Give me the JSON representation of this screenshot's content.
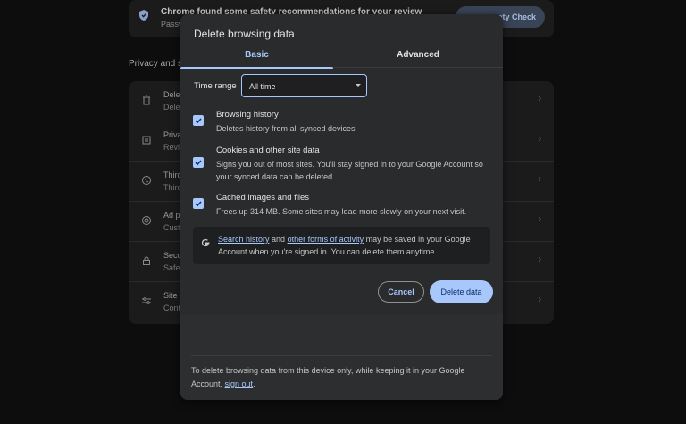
{
  "background": {
    "safety": {
      "title": "Chrome found some safety recommendations for your review",
      "subtitle": "Passw",
      "button": "ety Check"
    },
    "section_heading": "Privacy and s",
    "rows": [
      {
        "icon": "trash-icon",
        "l1": "Dele",
        "l2": "Delet"
      },
      {
        "icon": "privacy-guide-icon",
        "l1": "Priva",
        "l2": "Revie"
      },
      {
        "icon": "cookie-icon",
        "l1": "Third",
        "l2": "Third"
      },
      {
        "icon": "ad-privacy-icon",
        "l1": "Ad p",
        "l2": "Custo"
      },
      {
        "icon": "lock-icon",
        "l1": "Secu",
        "l2": "Safe"
      },
      {
        "icon": "sliders-icon",
        "l1": "Site s",
        "l2": "Cont"
      }
    ]
  },
  "dialog": {
    "title": "Delete browsing data",
    "tabs": {
      "basic": "Basic",
      "advanced": "Advanced"
    },
    "time_range": {
      "label": "Time range",
      "value": "All time"
    },
    "options": [
      {
        "title": "Browsing history",
        "desc": "Deletes history from all synced devices",
        "checked": true
      },
      {
        "title": "Cookies and other site data",
        "desc": "Signs you out of most sites. You'll stay signed in to your Google Account so your synced data can be deleted.",
        "checked": true
      },
      {
        "title": "Cached images and files",
        "desc": "Frees up 314 MB. Some sites may load more slowly on your next visit.",
        "checked": true
      }
    ],
    "info": {
      "link1": "Search history",
      "mid": " and ",
      "link2": "other forms of activity",
      "rest": " may be saved in your Google Account when you're signed in. You can delete them anytime."
    },
    "buttons": {
      "cancel": "Cancel",
      "delete": "Delete data"
    },
    "footer": {
      "text": "To delete browsing data from this device only, while keeping it in your Google Account, ",
      "link": "sign out",
      "end": "."
    }
  },
  "colors": {
    "accent": "#a8c7fa",
    "dialog_bg": "#2a2b2d",
    "page_bg": "#0d0d0e"
  }
}
